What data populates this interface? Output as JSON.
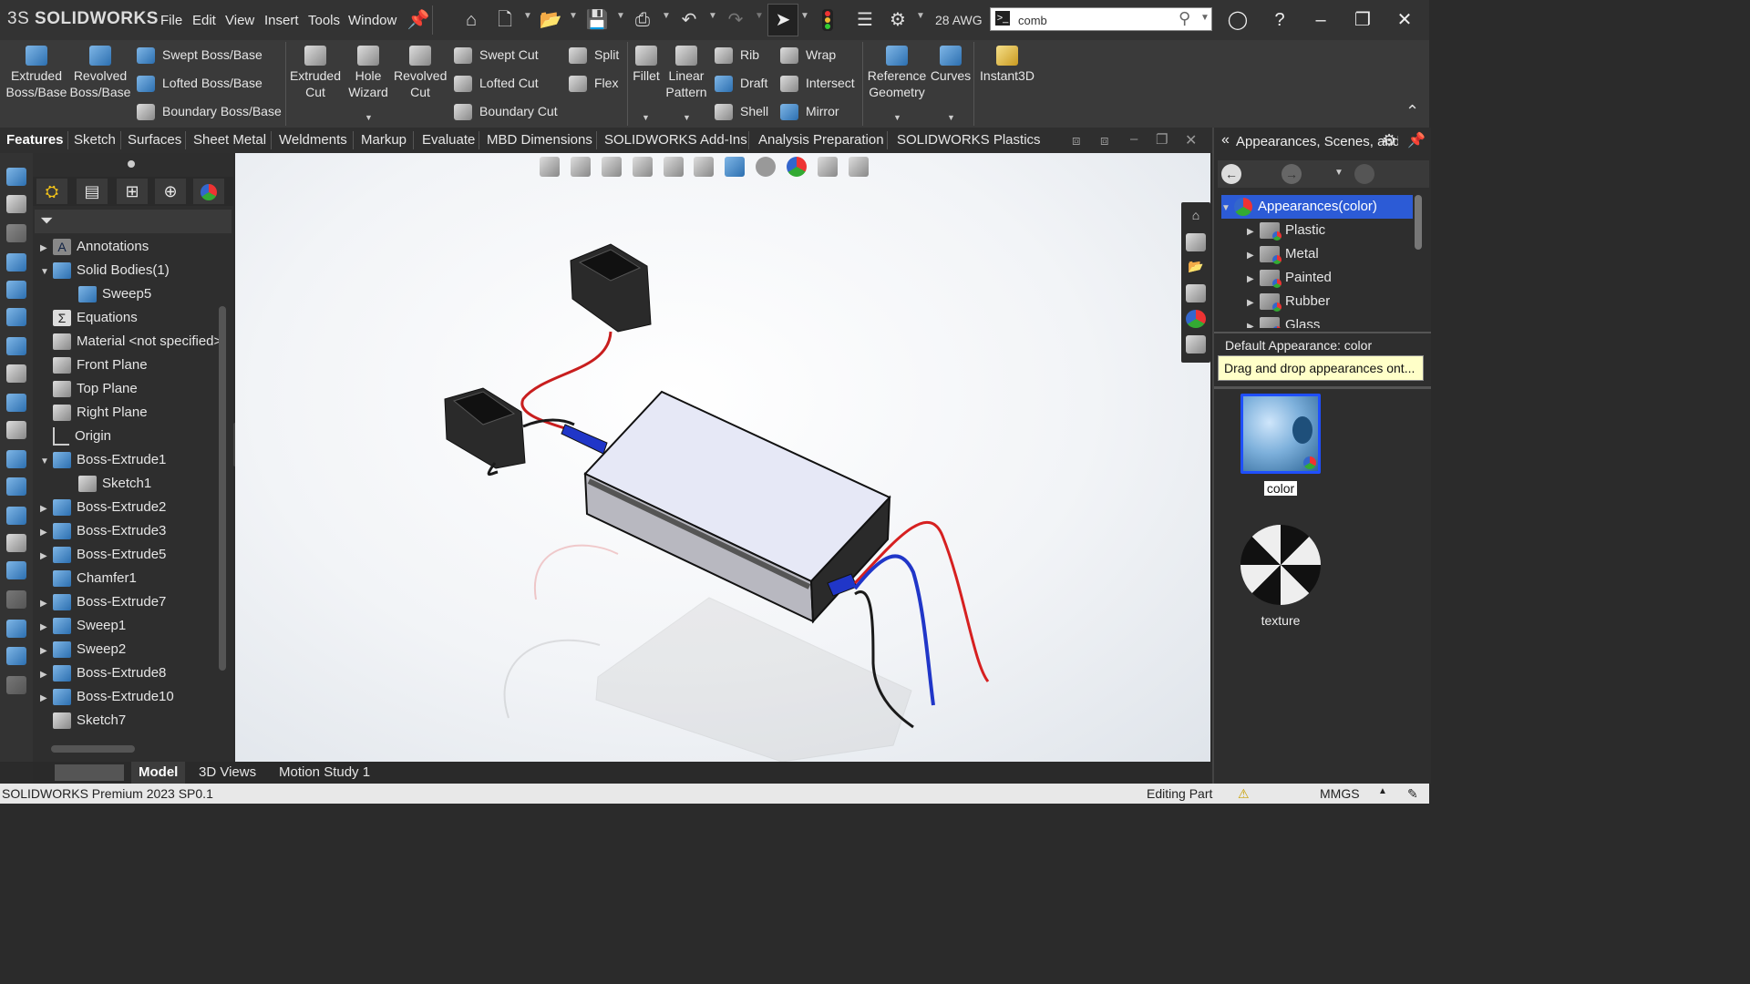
{
  "app": {
    "brand_prefix": "3S",
    "brand_name": "SOLIDWORKS"
  },
  "menu": [
    "File",
    "Edit",
    "View",
    "Insert",
    "Tools",
    "Window"
  ],
  "toolbar": {
    "wire_gauge": "28 AWG"
  },
  "search": {
    "value": "comb",
    "prompt_icon": "terminal-icon"
  },
  "ribbon": {
    "extruded_boss": "Extruded Boss/Base",
    "revolved_boss": "Revolved Boss/Base",
    "swept_boss": "Swept Boss/Base",
    "lofted_boss": "Lofted Boss/Base",
    "boundary_boss": "Boundary Boss/Base",
    "extruded_cut": "Extruded Cut",
    "hole_wizard": "Hole Wizard",
    "revolved_cut": "Revolved Cut",
    "swept_cut": "Swept Cut",
    "lofted_cut": "Lofted Cut",
    "boundary_cut": "Boundary Cut",
    "split": "Split",
    "flex": "Flex",
    "fillet": "Fillet",
    "linear_pattern": "Linear Pattern",
    "rib": "Rib",
    "draft": "Draft",
    "shell": "Shell",
    "wrap": "Wrap",
    "intersect": "Intersect",
    "mirror": "Mirror",
    "reference_geometry": "Reference Geometry",
    "curves": "Curves",
    "instant3d": "Instant3D"
  },
  "tabs": [
    "Features",
    "Sketch",
    "Surfaces",
    "Sheet Metal",
    "Weldments",
    "Markup",
    "Evaluate",
    "MBD Dimensions",
    "SOLIDWORKS Add-Ins",
    "Analysis Preparation",
    "SOLIDWORKS Plastics"
  ],
  "tree": [
    {
      "label": "Annotations",
      "arrow": "▶"
    },
    {
      "label": "Solid Bodies(1)",
      "arrow": "▼"
    },
    {
      "label": "Sweep5",
      "arrow": ""
    },
    {
      "label": "Equations",
      "arrow": ""
    },
    {
      "label": "Material <not specified>",
      "arrow": ""
    },
    {
      "label": "Front Plane",
      "arrow": ""
    },
    {
      "label": "Top Plane",
      "arrow": ""
    },
    {
      "label": "Right Plane",
      "arrow": ""
    },
    {
      "label": "Origin",
      "arrow": ""
    },
    {
      "label": "Boss-Extrude1",
      "arrow": "▼"
    },
    {
      "label": "Sketch1",
      "arrow": ""
    },
    {
      "label": "Boss-Extrude2",
      "arrow": "▶"
    },
    {
      "label": "Boss-Extrude3",
      "arrow": "▶"
    },
    {
      "label": "Boss-Extrude5",
      "arrow": "▶"
    },
    {
      "label": "Chamfer1",
      "arrow": ""
    },
    {
      "label": "Boss-Extrude7",
      "arrow": "▶"
    },
    {
      "label": "Sweep1",
      "arrow": "▶"
    },
    {
      "label": "Sweep2",
      "arrow": "▶"
    },
    {
      "label": "Boss-Extrude8",
      "arrow": "▶"
    },
    {
      "label": "Boss-Extrude10",
      "arrow": "▶"
    },
    {
      "label": "Sketch7",
      "arrow": ""
    }
  ],
  "taskpane": {
    "title": "Appearances, Scenes, and Decals",
    "root": "Appearances(color)",
    "items": [
      "Plastic",
      "Metal",
      "Painted",
      "Rubber",
      "Glass"
    ],
    "default_appearance": "Default Appearance: color",
    "tooltip": "Drag and drop appearances ont...",
    "swatch1": "color",
    "swatch2": "texture"
  },
  "bottom_tabs": [
    "Model",
    "3D Views",
    "Motion Study 1"
  ],
  "status": {
    "product": "SOLIDWORKS Premium 2023 SP0.1",
    "mode": "Editing Part",
    "units": "MMGS"
  },
  "colors": {
    "selection": "#1f4fff",
    "wire_red": "#d62020",
    "wire_blue": "#2036c8"
  }
}
